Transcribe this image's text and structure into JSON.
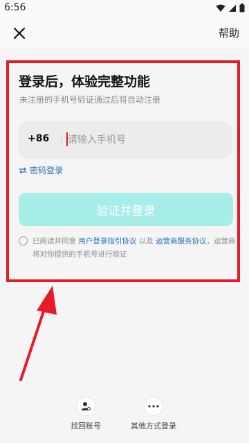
{
  "status_bar": {
    "time": "6:56"
  },
  "header": {
    "help_label": "帮助"
  },
  "login": {
    "title": "登录后，体验完整功能",
    "subtitle": "未注册的手机号验证通过后将自动注册",
    "country_code": "+86",
    "phone_placeholder": "请输入手机号",
    "phone_value": "",
    "password_login_label": "密码登录",
    "submit_label": "验证并登录",
    "agreement": {
      "prefix": "已阅读并同意 ",
      "user_agreement": "用户登录指引协议",
      "middle": " 以及 ",
      "carrier_agreement": "运营商服务协议",
      "suffix": "，运营商将对你提供的手机号进行验证"
    }
  },
  "bottom_options": {
    "recover_account": "找回账号",
    "other_methods": "其他方式登录"
  },
  "colors": {
    "accent": "#a7ede8",
    "highlight": "#e51a2b",
    "link": "#2c6fb8"
  }
}
